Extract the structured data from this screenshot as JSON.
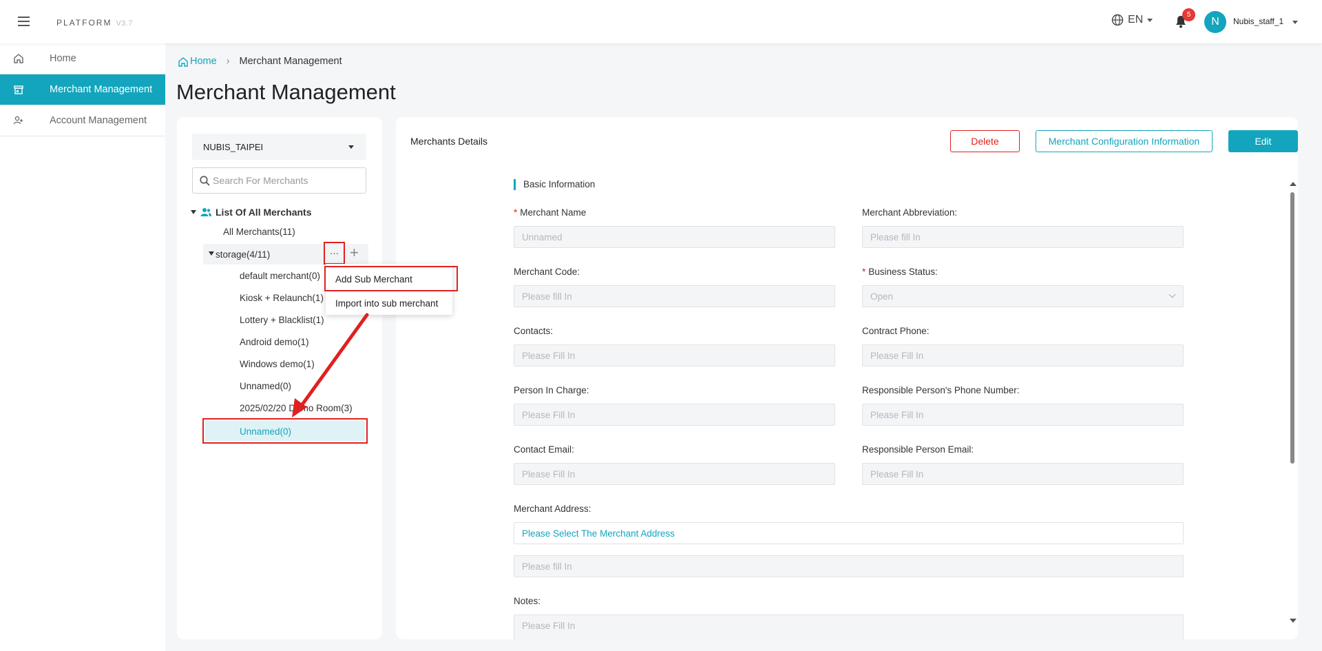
{
  "app": {
    "brand": "PLATFORM",
    "version": "V3.7"
  },
  "header": {
    "language": "EN",
    "notification_count": "5",
    "avatar_letter": "N",
    "username": "Nubis_staff_1"
  },
  "sidebar": {
    "items": [
      {
        "label": "Home",
        "icon": "home-icon"
      },
      {
        "label": "Merchant Management",
        "icon": "store-icon"
      },
      {
        "label": "Account Management",
        "icon": "users-icon"
      }
    ]
  },
  "breadcrumb": {
    "home": "Home",
    "current": "Merchant Management"
  },
  "page": {
    "title": "Merchant Management"
  },
  "merchant_tree": {
    "selected_company": "NUBIS_TAIPEI",
    "search_placeholder": "Search For Merchants",
    "root_label": "List Of All Merchants",
    "all_merchants": "All Merchants(11)",
    "storage": "storage(4/11)",
    "children": [
      "default merchant(0)",
      "Kiosk + Relaunch(1)",
      "Lottery + Blacklist(1)",
      "Android demo(1)",
      "Windows demo(1)",
      "Unnamed(0)",
      "2025/02/20 Demo Room(3)"
    ],
    "selected_child": "Unnamed(0)",
    "more_label": "···",
    "add_label": "+"
  },
  "context_menu": {
    "items": [
      "Add Sub Merchant",
      "Import into sub merchant"
    ]
  },
  "details": {
    "title": "Merchants Details",
    "buttons": {
      "delete": "Delete",
      "config": "Merchant Configuration Information",
      "edit": "Edit"
    },
    "section": "Basic Information",
    "fields": {
      "merchant_name": {
        "label": "Merchant Name",
        "placeholder": "Unnamed"
      },
      "merchant_abbr": {
        "label": "Merchant Abbreviation:",
        "placeholder": "Please fill In"
      },
      "merchant_code": {
        "label": "Merchant Code:",
        "placeholder": "Please fill In"
      },
      "business_status": {
        "label": "Business Status:",
        "value": "Open"
      },
      "contacts": {
        "label": "Contacts:",
        "placeholder": "Please Fill In"
      },
      "contract_phone": {
        "label": "Contract Phone:",
        "placeholder": "Please Fill In"
      },
      "person_in_charge": {
        "label": "Person In Charge:",
        "placeholder": "Please Fill In"
      },
      "responsible_phone": {
        "label": "Responsible Person's Phone Number:",
        "placeholder": "Please Fill In"
      },
      "contact_email": {
        "label": "Contact Email:",
        "placeholder": "Please Fill In"
      },
      "responsible_email": {
        "label": "Responsible Person Email:",
        "placeholder": "Please Fill In"
      },
      "merchant_address": {
        "label": "Merchant Address:",
        "select_text": "Please Select The Merchant Address",
        "detail_placeholder": "Please fill In"
      },
      "notes": {
        "label": "Notes:",
        "placeholder": "Please Fill In"
      }
    }
  },
  "colors": {
    "accent": "#12a5bd",
    "danger": "#e02020",
    "highlight": "#dff2f6"
  }
}
